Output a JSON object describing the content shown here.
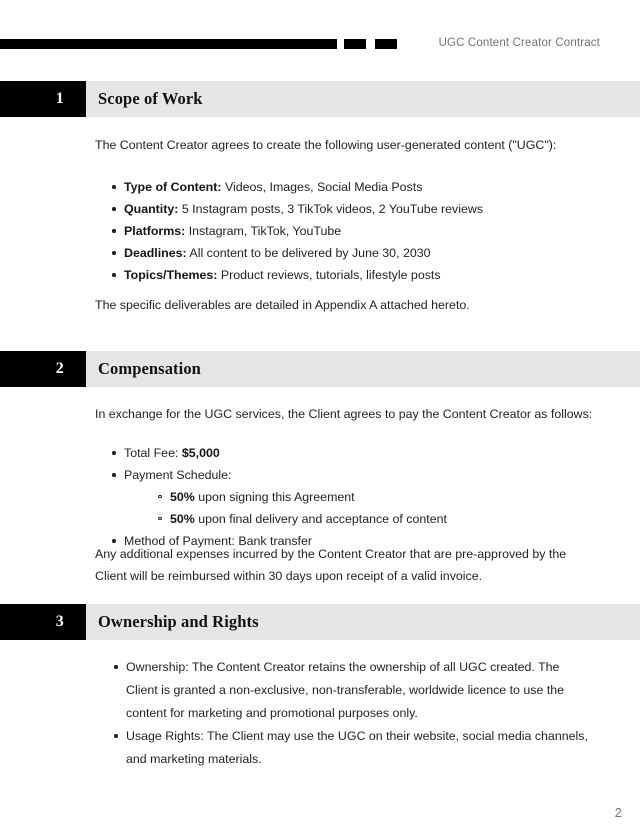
{
  "document": {
    "header_title": "UGC Content Creator Contract",
    "page_number": "2",
    "colors": {
      "band_gray": "#e5e6e8",
      "number_box": "#000000",
      "text": "#1f2022",
      "muted_text": "#6f7377"
    }
  },
  "sections": [
    {
      "number": "1",
      "title": "Scope of Work",
      "intro": "The Content Creator agrees to create the following user-generated content (\"UGC\"):",
      "bullets": [
        {
          "label": "Type of Content:",
          "text": " Videos, Images, Social Media Posts"
        },
        {
          "label": "Quantity:",
          "text": " 5 Instagram posts, 3 TikTok videos, 2 YouTube reviews"
        },
        {
          "label": "Platforms:",
          "text": " Instagram, TikTok, YouTube"
        },
        {
          "label": "Deadlines:",
          "text": " All content to be delivered by June 30, 2030"
        },
        {
          "label": "Topics/Themes:",
          "text": " Product reviews, tutorials, lifestyle posts"
        }
      ],
      "closing": "The specific deliverables are detailed in Appendix A attached hereto."
    },
    {
      "number": "2",
      "title": "Compensation",
      "intro": "In exchange for the UGC services, the Client agrees to pay the Content Creator as follows:",
      "bullets": [
        {
          "text": "Total Fee: ",
          "bold_tail": "$5,000"
        },
        {
          "text": "Payment Schedule:"
        },
        {
          "text": "Method of Payment: Bank transfer"
        }
      ],
      "sub_bullets": [
        {
          "label": "50%",
          "text": " upon signing this Agreement"
        },
        {
          "label": "50%",
          "text": " upon final delivery and acceptance of content"
        }
      ],
      "closing": "Any additional expenses incurred by the Content Creator that are pre-approved by the Client will be reimbursed within 30 days upon receipt of a valid invoice."
    },
    {
      "number": "3",
      "title": "Ownership and Rights",
      "bullets": [
        {
          "text": "Ownership: The Content Creator retains the ownership of all UGC created. The Client is granted a non-exclusive, non-transferable, worldwide licence to use the content for marketing and promotional purposes only."
        },
        {
          "text": "Usage Rights: The Client may use the UGC on their website, social media channels, and marketing materials."
        }
      ]
    }
  ]
}
